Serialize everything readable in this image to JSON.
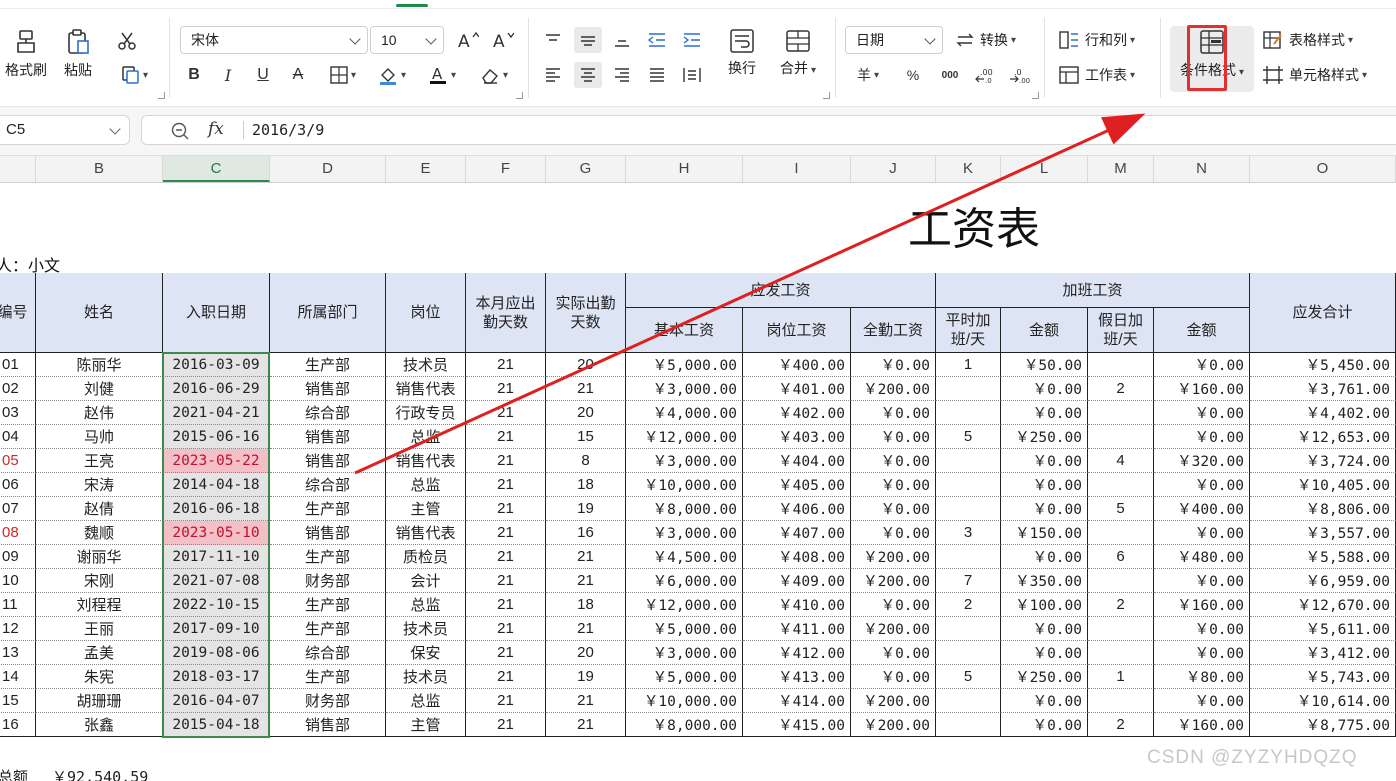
{
  "ribbon": {
    "format_painter": "格式刷",
    "paste": "粘贴",
    "font_name": "宋体",
    "font_size": "10",
    "wrap": "换行",
    "merge": "合并",
    "number_format": "日期",
    "convert": "转换",
    "rows_cols": "行和列",
    "worksheet": "工作表",
    "conditional_format": "条件格式",
    "table_style": "表格样式",
    "cell_style": "单元格样式",
    "currency_symbol": "羊",
    "percent": "%",
    "thousands": "000"
  },
  "formula_bar": {
    "cell_ref": "C5",
    "fx": "fx",
    "value": "2016/3/9"
  },
  "columns": [
    "B",
    "C",
    "D",
    "E",
    "F",
    "G",
    "H",
    "I",
    "J",
    "K",
    "L",
    "M",
    "N",
    "O"
  ],
  "sheet": {
    "title": "工资表",
    "maker": "人：小文",
    "headers": {
      "id": "编号",
      "name": "姓名",
      "date": "入职日期",
      "dept": "所属部门",
      "post": "岗位",
      "due_days": "本月应出勤天数",
      "actual_days": "实际出勤天数",
      "payable": "应发工资",
      "base": "基本工资",
      "post_pay": "岗位工资",
      "attend": "全勤工资",
      "overtime": "加班工资",
      "ot_days": "平时加班/天",
      "ot_amount": "金额",
      "hol_days": "假日加班/天",
      "hol_amount": "金额",
      "total": "应发合计"
    },
    "rows": [
      {
        "id": "01",
        "name": "陈丽华",
        "date": "2016-03-09",
        "dept": "生产部",
        "post": "技术员",
        "due": "21",
        "act": "20",
        "base": "￥5,000.00",
        "postpay": "￥400.00",
        "attend": "￥0.00",
        "otd": "1",
        "ota": "￥50.00",
        "hold": "",
        "hola": "￥0.00",
        "total": "￥5,450.00",
        "hl": false
      },
      {
        "id": "02",
        "name": "刘健",
        "date": "2016-06-29",
        "dept": "销售部",
        "post": "销售代表",
        "due": "21",
        "act": "21",
        "base": "￥3,000.00",
        "postpay": "￥401.00",
        "attend": "￥200.00",
        "otd": "",
        "ota": "￥0.00",
        "hold": "2",
        "hola": "￥160.00",
        "total": "￥3,761.00",
        "hl": false
      },
      {
        "id": "03",
        "name": "赵伟",
        "date": "2021-04-21",
        "dept": "综合部",
        "post": "行政专员",
        "due": "21",
        "act": "20",
        "base": "￥4,000.00",
        "postpay": "￥402.00",
        "attend": "￥0.00",
        "otd": "",
        "ota": "￥0.00",
        "hold": "",
        "hola": "￥0.00",
        "total": "￥4,402.00",
        "hl": false
      },
      {
        "id": "04",
        "name": "马帅",
        "date": "2015-06-16",
        "dept": "销售部",
        "post": "总监",
        "due": "21",
        "act": "15",
        "base": "￥12,000.00",
        "postpay": "￥403.00",
        "attend": "￥0.00",
        "otd": "5",
        "ota": "￥250.00",
        "hold": "",
        "hola": "￥0.00",
        "total": "￥12,653.00",
        "hl": false
      },
      {
        "id": "05",
        "name": "王亮",
        "date": "2023-05-22",
        "dept": "销售部",
        "post": "销售代表",
        "due": "21",
        "act": "8",
        "base": "￥3,000.00",
        "postpay": "￥404.00",
        "attend": "￥0.00",
        "otd": "",
        "ota": "￥0.00",
        "hold": "4",
        "hola": "￥320.00",
        "total": "￥3,724.00",
        "hl": true
      },
      {
        "id": "06",
        "name": "宋涛",
        "date": "2014-04-18",
        "dept": "综合部",
        "post": "总监",
        "due": "21",
        "act": "18",
        "base": "￥10,000.00",
        "postpay": "￥405.00",
        "attend": "￥0.00",
        "otd": "",
        "ota": "￥0.00",
        "hold": "",
        "hola": "￥0.00",
        "total": "￥10,405.00",
        "hl": false
      },
      {
        "id": "07",
        "name": "赵倩",
        "date": "2016-06-18",
        "dept": "生产部",
        "post": "主管",
        "due": "21",
        "act": "19",
        "base": "￥8,000.00",
        "postpay": "￥406.00",
        "attend": "￥0.00",
        "otd": "",
        "ota": "￥0.00",
        "hold": "5",
        "hola": "￥400.00",
        "total": "￥8,806.00",
        "hl": false
      },
      {
        "id": "08",
        "name": "魏顺",
        "date": "2023-05-10",
        "dept": "销售部",
        "post": "销售代表",
        "due": "21",
        "act": "16",
        "base": "￥3,000.00",
        "postpay": "￥407.00",
        "attend": "￥0.00",
        "otd": "3",
        "ota": "￥150.00",
        "hold": "",
        "hola": "￥0.00",
        "total": "￥3,557.00",
        "hl": true
      },
      {
        "id": "09",
        "name": "谢丽华",
        "date": "2017-11-10",
        "dept": "生产部",
        "post": "质检员",
        "due": "21",
        "act": "21",
        "base": "￥4,500.00",
        "postpay": "￥408.00",
        "attend": "￥200.00",
        "otd": "",
        "ota": "￥0.00",
        "hold": "6",
        "hola": "￥480.00",
        "total": "￥5,588.00",
        "hl": false
      },
      {
        "id": "10",
        "name": "宋刚",
        "date": "2021-07-08",
        "dept": "财务部",
        "post": "会计",
        "due": "21",
        "act": "21",
        "base": "￥6,000.00",
        "postpay": "￥409.00",
        "attend": "￥200.00",
        "otd": "7",
        "ota": "￥350.00",
        "hold": "",
        "hola": "￥0.00",
        "total": "￥6,959.00",
        "hl": false
      },
      {
        "id": "11",
        "name": "刘程程",
        "date": "2022-10-15",
        "dept": "生产部",
        "post": "总监",
        "due": "21",
        "act": "18",
        "base": "￥12,000.00",
        "postpay": "￥410.00",
        "attend": "￥0.00",
        "otd": "2",
        "ota": "￥100.00",
        "hold": "2",
        "hola": "￥160.00",
        "total": "￥12,670.00",
        "hl": false
      },
      {
        "id": "12",
        "name": "王丽",
        "date": "2017-09-10",
        "dept": "生产部",
        "post": "技术员",
        "due": "21",
        "act": "21",
        "base": "￥5,000.00",
        "postpay": "￥411.00",
        "attend": "￥200.00",
        "otd": "",
        "ota": "￥0.00",
        "hold": "",
        "hola": "￥0.00",
        "total": "￥5,611.00",
        "hl": false
      },
      {
        "id": "13",
        "name": "孟美",
        "date": "2019-08-06",
        "dept": "综合部",
        "post": "保安",
        "due": "21",
        "act": "20",
        "base": "￥3,000.00",
        "postpay": "￥412.00",
        "attend": "￥0.00",
        "otd": "",
        "ota": "￥0.00",
        "hold": "",
        "hola": "￥0.00",
        "total": "￥3,412.00",
        "hl": false
      },
      {
        "id": "14",
        "name": "朱宪",
        "date": "2018-03-17",
        "dept": "生产部",
        "post": "技术员",
        "due": "21",
        "act": "19",
        "base": "￥5,000.00",
        "postpay": "￥413.00",
        "attend": "￥0.00",
        "otd": "5",
        "ota": "￥250.00",
        "hold": "1",
        "hola": "￥80.00",
        "total": "￥5,743.00",
        "hl": false
      },
      {
        "id": "15",
        "name": "胡珊珊",
        "date": "2016-04-07",
        "dept": "财务部",
        "post": "总监",
        "due": "21",
        "act": "21",
        "base": "￥10,000.00",
        "postpay": "￥414.00",
        "attend": "￥200.00",
        "otd": "",
        "ota": "￥0.00",
        "hold": "",
        "hola": "￥0.00",
        "total": "￥10,614.00",
        "hl": false
      },
      {
        "id": "16",
        "name": "张鑫",
        "date": "2015-04-18",
        "dept": "销售部",
        "post": "主管",
        "due": "21",
        "act": "21",
        "base": "￥8,000.00",
        "postpay": "￥415.00",
        "attend": "￥200.00",
        "otd": "",
        "ota": "￥0.00",
        "hold": "2",
        "hola": "￥160.00",
        "total": "￥8,775.00",
        "hl": false
      }
    ],
    "total_label": "总额",
    "total_value": "￥92,540.59"
  },
  "watermark": "CSDN @ZYZYHDQZQ",
  "colors": {
    "header_bg": "#dde5f4",
    "highlight_bg": "#f4c0c8",
    "highlight_text": "#c0102a",
    "selection": "#3e8a4a",
    "annotation": "#e03030"
  }
}
